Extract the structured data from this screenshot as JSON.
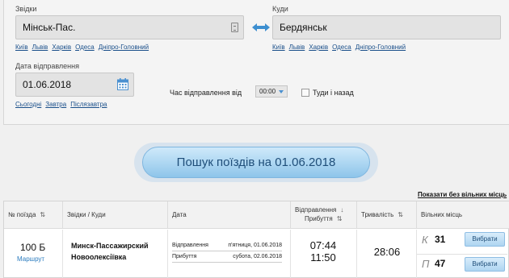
{
  "search": {
    "from_label": "Звідки",
    "from_value": "Мінськ-Пас.",
    "to_label": "Куди",
    "to_value": "Бердянськ",
    "from_quick": [
      "Київ",
      "Львів",
      "Харків",
      "Одеса",
      "Дніпро-Головний"
    ],
    "to_quick": [
      "Київ",
      "Львів",
      "Харків",
      "Одеса",
      "Дніпро-Головний"
    ],
    "date_label": "Дата відправлення",
    "date_value": "01.06.2018",
    "date_quick": [
      "Сьогодні",
      "Завтра",
      "Післязавтра"
    ],
    "time_label": "Час відправлення від",
    "time_value": "00:00",
    "roundtrip_label": "Туди і назад",
    "search_button": "Пошук поїздів на 01.06.2018"
  },
  "results": {
    "show_all_link": "Показати без вільних місць",
    "headers": {
      "train_no": "№ поїзда",
      "route": "Звідки / Куди",
      "date": "Дата",
      "dep_arr_1": "Відправлення",
      "dep_arr_2": "Прибуття",
      "duration": "Тривалість",
      "seats": "Вільних місць"
    },
    "row": {
      "train_no": "100 Б",
      "route_link": "Маршрут",
      "from_station": "Минск-Пассажирский",
      "to_station": "Новоолексіївка",
      "dep_label": "Відправлення",
      "dep_date": "п'ятниця, 01.06.2018",
      "arr_label": "Прибуття",
      "arr_date": "субота, 02.06.2018",
      "dep_time": "07:44",
      "arr_time": "11:50",
      "duration": "28:06",
      "places": [
        {
          "type": "К",
          "count": "31",
          "button": "Вибрати"
        },
        {
          "type": "П",
          "count": "47",
          "button": "Вибрати"
        }
      ]
    }
  },
  "colors": {
    "link": "#1a4f8a",
    "accent": "#4a90d0",
    "button_text": "#1f4e79"
  }
}
